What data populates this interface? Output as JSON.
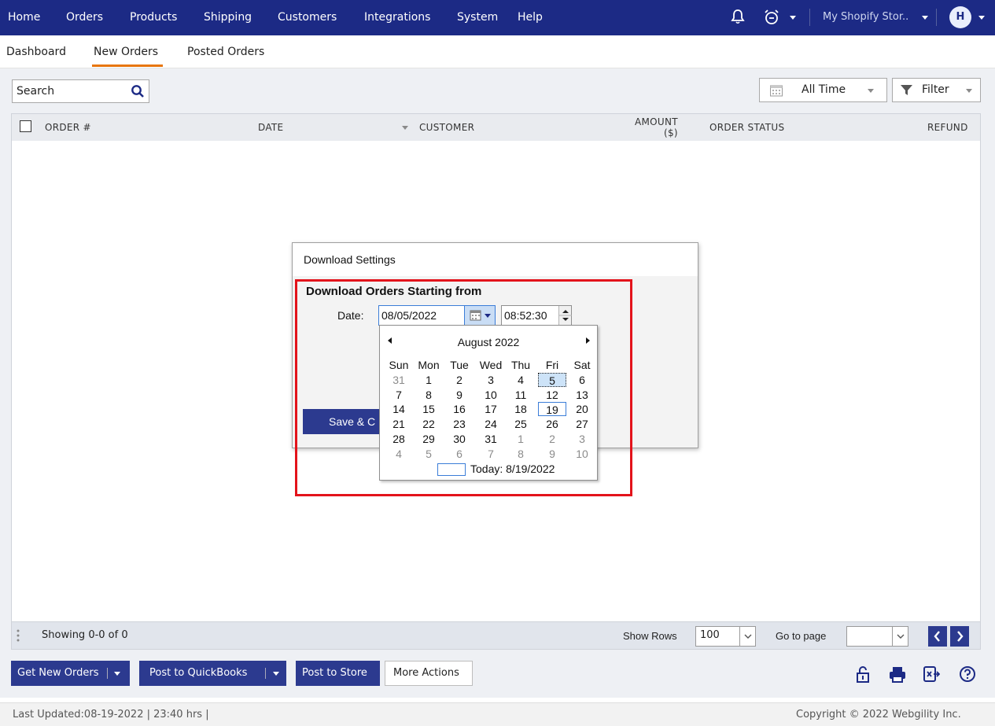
{
  "nav": {
    "items": [
      "Home",
      "Orders",
      "Products",
      "Shipping",
      "Customers",
      "Integrations",
      "System",
      "Help"
    ],
    "store": "My Shopify Stor..",
    "avatar": "H"
  },
  "tabs": [
    "Dashboard",
    "New Orders",
    "Posted Orders"
  ],
  "active_tab": "New Orders",
  "search": {
    "value": "Search"
  },
  "date_range": "All Time",
  "filter_label": "Filter",
  "grid": {
    "columns": [
      "ORDER #",
      "DATE",
      "CUSTOMER",
      "AMOUNT",
      "($)",
      "ORDER STATUS",
      "REFUND"
    ]
  },
  "pager": {
    "showing": "Showing 0-0 of 0",
    "show_rows_label": "Show Rows",
    "rows_value": "100",
    "goto_label": "Go to page",
    "goto_value": ""
  },
  "actions": {
    "get_new_orders": "Get New Orders",
    "post_qb": "Post to QuickBooks",
    "post_store": "Post to Store",
    "more": "More Actions"
  },
  "footer": {
    "last_updated": "Last Updated:08-19-2022 | 23:40 hrs |",
    "copyright": "Copyright © 2022 Webgility Inc."
  },
  "dialog": {
    "title": "Download Settings",
    "heading": "Download Orders Starting from",
    "date_label": "Date:",
    "date_value": "08/05/2022",
    "time_value": "08:52:30",
    "save_button": "Save & C"
  },
  "calendar": {
    "month_label": "August 2022",
    "weekdays": [
      "Sun",
      "Mon",
      "Tue",
      "Wed",
      "Thu",
      "Fri",
      "Sat"
    ],
    "weeks": [
      [
        "31",
        "1",
        "2",
        "3",
        "4",
        "5",
        "6"
      ],
      [
        "7",
        "8",
        "9",
        "10",
        "11",
        "12",
        "13"
      ],
      [
        "14",
        "15",
        "16",
        "17",
        "18",
        "19",
        "20"
      ],
      [
        "21",
        "22",
        "23",
        "24",
        "25",
        "26",
        "27"
      ],
      [
        "28",
        "29",
        "30",
        "31",
        "1",
        "2",
        "3"
      ],
      [
        "4",
        "5",
        "6",
        "7",
        "8",
        "9",
        "10"
      ]
    ],
    "selected_day": "5",
    "today_day": "19",
    "today_label": "Today: 8/19/2022"
  },
  "colors": {
    "nav_bg": "#1c2a85",
    "active_tab_accent": "#e8760e",
    "button_blue": "#2c3a8f",
    "highlight_red": "#e3131b"
  },
  "icons": [
    "bell-icon",
    "alarm-clock-icon",
    "search-icon",
    "calendar-icon",
    "filter-icon",
    "unlock-icon",
    "print-icon",
    "export-excel-icon",
    "help-icon"
  ]
}
